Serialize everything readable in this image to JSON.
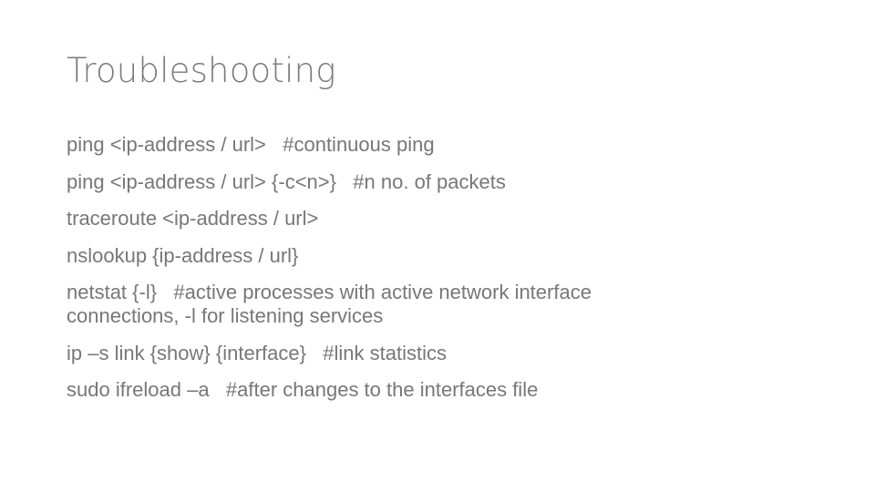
{
  "slide": {
    "title": "Troubleshooting",
    "lines": [
      "ping <ip-address / url>   #continuous ping",
      "ping <ip-address / url> {-c<n>}   #n no. of packets",
      "traceroute <ip-address / url>",
      "nslookup {ip-address / url}",
      "netstat {-l}   #active processes with active network interface connections, -l for listening services",
      "ip –s link {show} {interface}   #link statistics",
      "sudo ifreload –a   #after changes to the interfaces file"
    ]
  }
}
